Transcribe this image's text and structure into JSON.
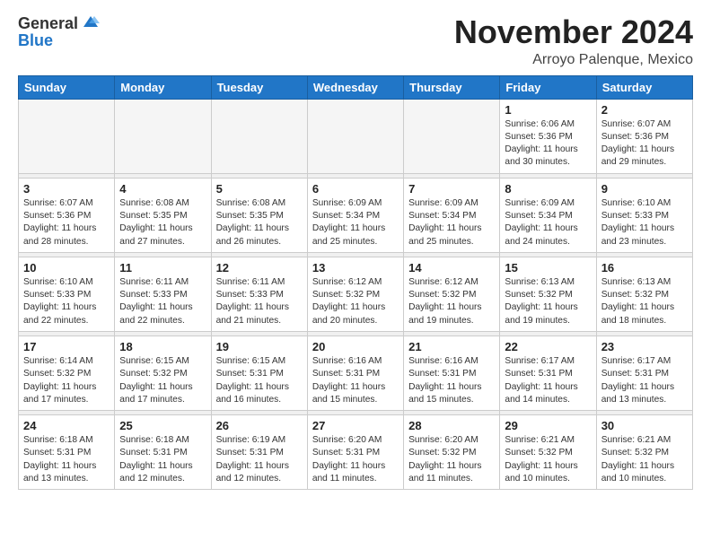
{
  "header": {
    "logo_general": "General",
    "logo_blue": "Blue",
    "month_title": "November 2024",
    "location": "Arroyo Palenque, Mexico"
  },
  "weekdays": [
    "Sunday",
    "Monday",
    "Tuesday",
    "Wednesday",
    "Thursday",
    "Friday",
    "Saturday"
  ],
  "weeks": [
    [
      {
        "day": "",
        "info": ""
      },
      {
        "day": "",
        "info": ""
      },
      {
        "day": "",
        "info": ""
      },
      {
        "day": "",
        "info": ""
      },
      {
        "day": "",
        "info": ""
      },
      {
        "day": "1",
        "info": "Sunrise: 6:06 AM\nSunset: 5:36 PM\nDaylight: 11 hours\nand 30 minutes."
      },
      {
        "day": "2",
        "info": "Sunrise: 6:07 AM\nSunset: 5:36 PM\nDaylight: 11 hours\nand 29 minutes."
      }
    ],
    [
      {
        "day": "3",
        "info": "Sunrise: 6:07 AM\nSunset: 5:36 PM\nDaylight: 11 hours\nand 28 minutes."
      },
      {
        "day": "4",
        "info": "Sunrise: 6:08 AM\nSunset: 5:35 PM\nDaylight: 11 hours\nand 27 minutes."
      },
      {
        "day": "5",
        "info": "Sunrise: 6:08 AM\nSunset: 5:35 PM\nDaylight: 11 hours\nand 26 minutes."
      },
      {
        "day": "6",
        "info": "Sunrise: 6:09 AM\nSunset: 5:34 PM\nDaylight: 11 hours\nand 25 minutes."
      },
      {
        "day": "7",
        "info": "Sunrise: 6:09 AM\nSunset: 5:34 PM\nDaylight: 11 hours\nand 25 minutes."
      },
      {
        "day": "8",
        "info": "Sunrise: 6:09 AM\nSunset: 5:34 PM\nDaylight: 11 hours\nand 24 minutes."
      },
      {
        "day": "9",
        "info": "Sunrise: 6:10 AM\nSunset: 5:33 PM\nDaylight: 11 hours\nand 23 minutes."
      }
    ],
    [
      {
        "day": "10",
        "info": "Sunrise: 6:10 AM\nSunset: 5:33 PM\nDaylight: 11 hours\nand 22 minutes."
      },
      {
        "day": "11",
        "info": "Sunrise: 6:11 AM\nSunset: 5:33 PM\nDaylight: 11 hours\nand 22 minutes."
      },
      {
        "day": "12",
        "info": "Sunrise: 6:11 AM\nSunset: 5:33 PM\nDaylight: 11 hours\nand 21 minutes."
      },
      {
        "day": "13",
        "info": "Sunrise: 6:12 AM\nSunset: 5:32 PM\nDaylight: 11 hours\nand 20 minutes."
      },
      {
        "day": "14",
        "info": "Sunrise: 6:12 AM\nSunset: 5:32 PM\nDaylight: 11 hours\nand 19 minutes."
      },
      {
        "day": "15",
        "info": "Sunrise: 6:13 AM\nSunset: 5:32 PM\nDaylight: 11 hours\nand 19 minutes."
      },
      {
        "day": "16",
        "info": "Sunrise: 6:13 AM\nSunset: 5:32 PM\nDaylight: 11 hours\nand 18 minutes."
      }
    ],
    [
      {
        "day": "17",
        "info": "Sunrise: 6:14 AM\nSunset: 5:32 PM\nDaylight: 11 hours\nand 17 minutes."
      },
      {
        "day": "18",
        "info": "Sunrise: 6:15 AM\nSunset: 5:32 PM\nDaylight: 11 hours\nand 17 minutes."
      },
      {
        "day": "19",
        "info": "Sunrise: 6:15 AM\nSunset: 5:31 PM\nDaylight: 11 hours\nand 16 minutes."
      },
      {
        "day": "20",
        "info": "Sunrise: 6:16 AM\nSunset: 5:31 PM\nDaylight: 11 hours\nand 15 minutes."
      },
      {
        "day": "21",
        "info": "Sunrise: 6:16 AM\nSunset: 5:31 PM\nDaylight: 11 hours\nand 15 minutes."
      },
      {
        "day": "22",
        "info": "Sunrise: 6:17 AM\nSunset: 5:31 PM\nDaylight: 11 hours\nand 14 minutes."
      },
      {
        "day": "23",
        "info": "Sunrise: 6:17 AM\nSunset: 5:31 PM\nDaylight: 11 hours\nand 13 minutes."
      }
    ],
    [
      {
        "day": "24",
        "info": "Sunrise: 6:18 AM\nSunset: 5:31 PM\nDaylight: 11 hours\nand 13 minutes."
      },
      {
        "day": "25",
        "info": "Sunrise: 6:18 AM\nSunset: 5:31 PM\nDaylight: 11 hours\nand 12 minutes."
      },
      {
        "day": "26",
        "info": "Sunrise: 6:19 AM\nSunset: 5:31 PM\nDaylight: 11 hours\nand 12 minutes."
      },
      {
        "day": "27",
        "info": "Sunrise: 6:20 AM\nSunset: 5:31 PM\nDaylight: 11 hours\nand 11 minutes."
      },
      {
        "day": "28",
        "info": "Sunrise: 6:20 AM\nSunset: 5:32 PM\nDaylight: 11 hours\nand 11 minutes."
      },
      {
        "day": "29",
        "info": "Sunrise: 6:21 AM\nSunset: 5:32 PM\nDaylight: 11 hours\nand 10 minutes."
      },
      {
        "day": "30",
        "info": "Sunrise: 6:21 AM\nSunset: 5:32 PM\nDaylight: 11 hours\nand 10 minutes."
      }
    ]
  ]
}
